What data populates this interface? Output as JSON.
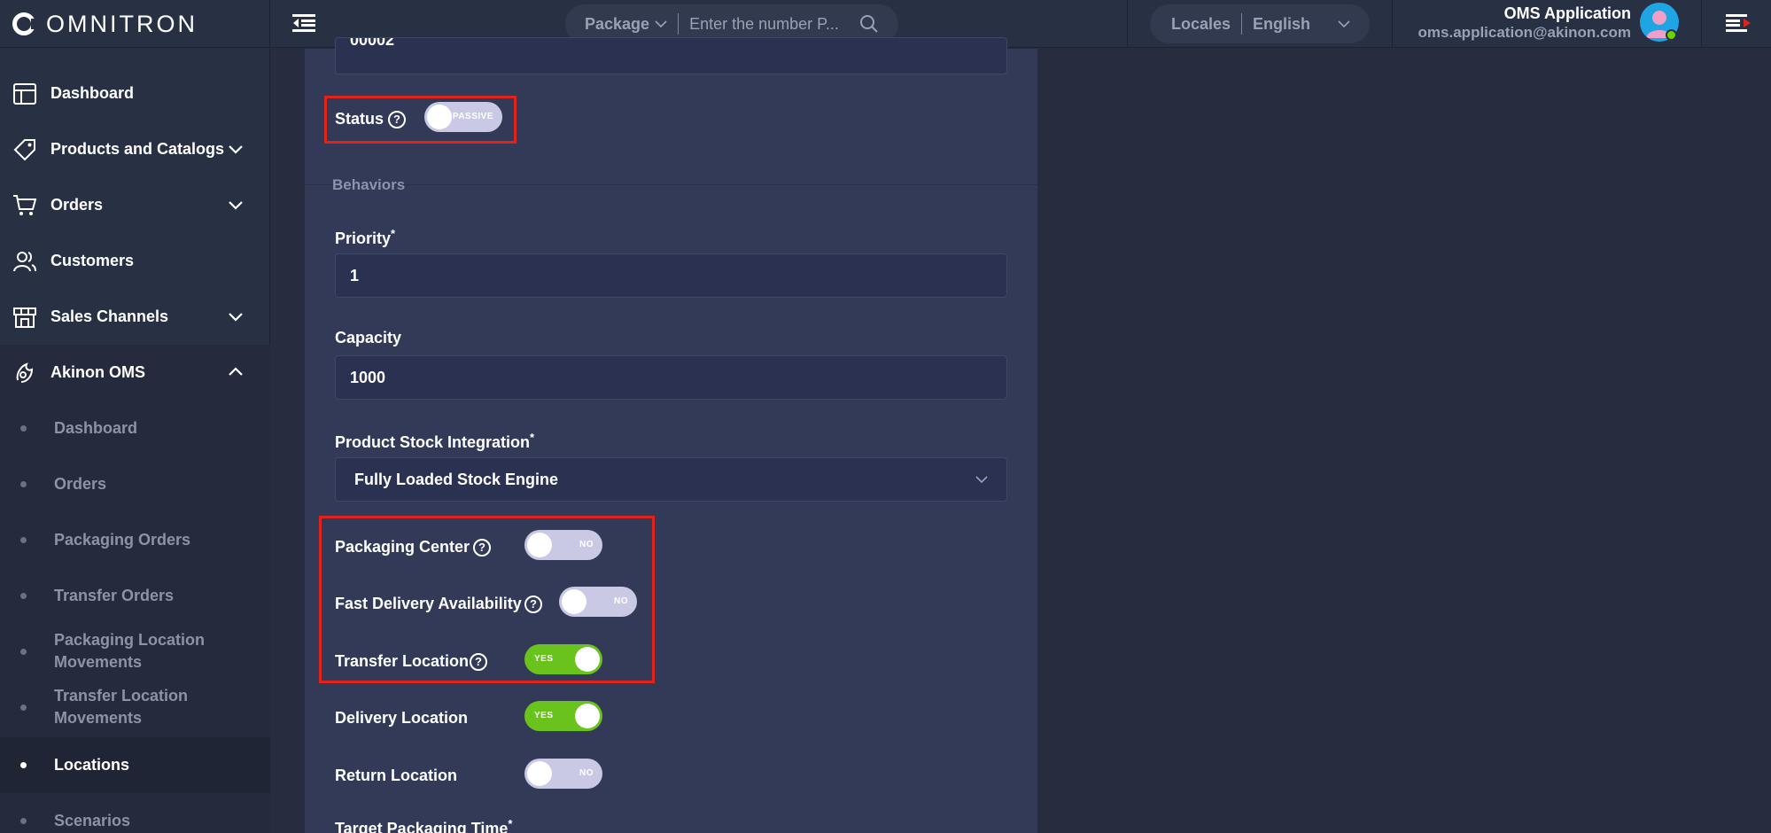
{
  "app": {
    "logo_text": "OMNITRON"
  },
  "header": {
    "search_type": "Package",
    "search_placeholder": "Enter the number P...",
    "locales_label": "Locales",
    "locale_value": "English",
    "user_name": "OMS Application",
    "user_email": "oms.application@akinon.com"
  },
  "sidebar": {
    "items": [
      {
        "label": "Dashboard",
        "icon": "dashboard-icon"
      },
      {
        "label": "Products and Catalogs",
        "icon": "tag-icon"
      },
      {
        "label": "Orders",
        "icon": "cart-icon"
      },
      {
        "label": "Customers",
        "icon": "users-icon"
      },
      {
        "label": "Sales Channels",
        "icon": "store-icon"
      },
      {
        "label": "Akinon OMS",
        "icon": "oms-icon"
      }
    ],
    "sub_items": [
      {
        "label": "Dashboard"
      },
      {
        "label": "Orders"
      },
      {
        "label": "Packaging Orders"
      },
      {
        "label": "Transfer Orders"
      },
      {
        "label": "Packaging Location Movements"
      },
      {
        "label": "Transfer Location Movements"
      },
      {
        "label": "Locations",
        "active": true
      },
      {
        "label": "Scenarios"
      }
    ]
  },
  "form": {
    "top_field_value": "00002",
    "status_label": "Status",
    "status_toggle": "PASSIVE",
    "behaviors_title": "Behaviors",
    "priority_label": "Priority",
    "priority_value": "1",
    "capacity_label": "Capacity",
    "capacity_value": "1000",
    "stock_integration_label": "Product Stock Integration",
    "stock_integration_value": "Fully Loaded Stock Engine",
    "required_mark": "*",
    "toggles": [
      {
        "label": "Packaging Center",
        "state": "NO",
        "on": false
      },
      {
        "label": "Fast Delivery Availability",
        "state": "NO",
        "on": false
      },
      {
        "label": "Transfer Location",
        "state": "YES",
        "on": true
      },
      {
        "label": "Delivery Location",
        "state": "YES",
        "on": true
      },
      {
        "label": "Return Location",
        "state": "NO",
        "on": false
      }
    ],
    "target_packaging_label": "Target Packaging Time"
  },
  "colors": {
    "highlight": "#e0241b",
    "toggle_on": "#6ac31c",
    "toggle_off": "#c9c9e6",
    "accent_avatar": "#1fa4e4"
  }
}
